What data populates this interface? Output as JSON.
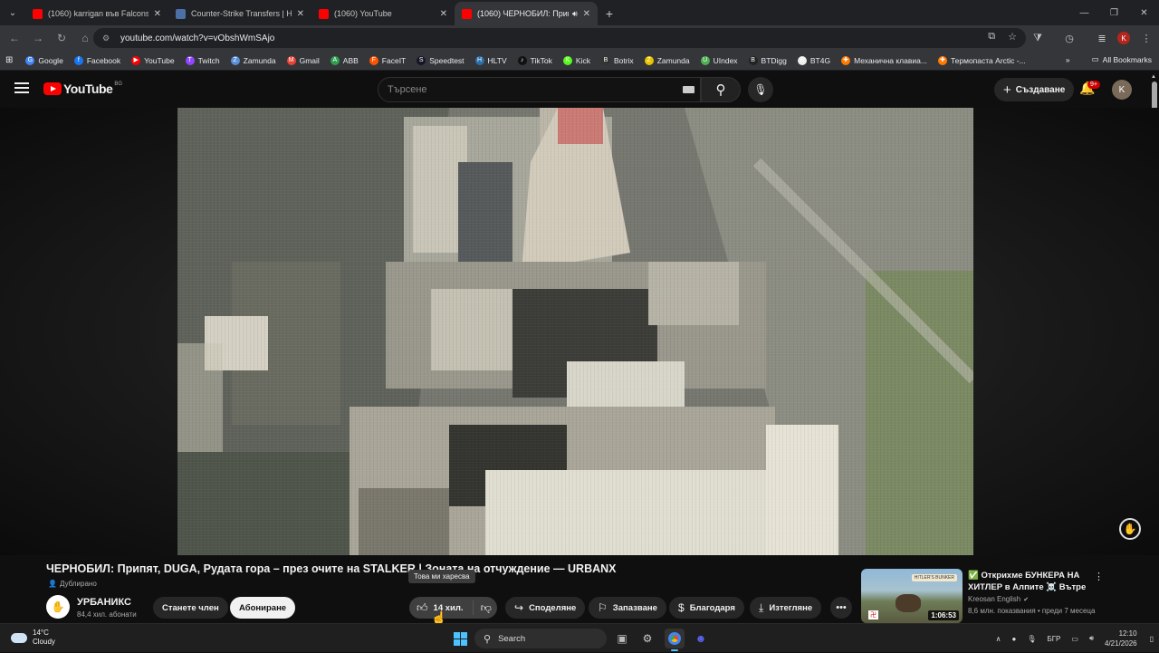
{
  "browser": {
    "tabs": [
      {
        "title": "(1060) karrigan във Falcons?! ",
        "favicon_color": "#ff0000",
        "active": false
      },
      {
        "title": "Counter-Strike Transfers | HLTV",
        "favicon_color": "#4c6fa8",
        "active": false
      },
      {
        "title": "(1060) YouTube",
        "favicon_color": "#ff0000",
        "active": false
      },
      {
        "title": "(1060) ЧЕРНОБИЛ: Припя",
        "favicon_color": "#ff0000",
        "active": true
      }
    ],
    "new_tab": "+",
    "url": "youtube.com/watch?v=vObshWmSAjo",
    "profile_initial": "K",
    "bookmarks": [
      {
        "label": "Google",
        "color": "#4285f4",
        "glyph": "G"
      },
      {
        "label": "Facebook",
        "color": "#1877f2",
        "glyph": "f"
      },
      {
        "label": "YouTube",
        "color": "#ff0000",
        "glyph": "▶"
      },
      {
        "label": "Twitch",
        "color": "#9146ff",
        "glyph": "T"
      },
      {
        "label": "Zamunda",
        "color": "#5a8fd8",
        "glyph": "Z"
      },
      {
        "label": "Gmail",
        "color": "#ea4335",
        "glyph": "M"
      },
      {
        "label": "ABB",
        "color": "#2e9e4f",
        "glyph": "A"
      },
      {
        "label": "FaceIT",
        "color": "#ff5500",
        "glyph": "F"
      },
      {
        "label": "Speedtest",
        "color": "#141526",
        "glyph": "S"
      },
      {
        "label": "HLTV",
        "color": "#2b6ea6",
        "glyph": "H"
      },
      {
        "label": "TikTok",
        "color": "#111111",
        "glyph": "♪"
      },
      {
        "label": "Kick",
        "color": "#53fc18",
        "glyph": "K"
      },
      {
        "label": "Botrix",
        "color": "#333333",
        "glyph": "B"
      },
      {
        "label": "Zamunda",
        "color": "#e8c400",
        "glyph": "Z"
      },
      {
        "label": "UIndex",
        "color": "#4caf50",
        "glyph": "U"
      },
      {
        "label": "BTDigg",
        "color": "#222222",
        "glyph": "B"
      },
      {
        "label": "BT4G",
        "color": "#eeeeee",
        "glyph": "B"
      },
      {
        "label": "Механична клавиа...",
        "color": "#ff7a00",
        "glyph": "✚"
      },
      {
        "label": "Термопаста Arctic -...",
        "color": "#ff7a00",
        "glyph": "✚"
      }
    ],
    "all_bookmarks": "All Bookmarks"
  },
  "youtube": {
    "logo_text": "YouTube",
    "country_code": "BG",
    "search_placeholder": "Търсене",
    "create_label": "Създаване",
    "notif_badge": "9+",
    "avatar_initial": "K"
  },
  "video": {
    "title": "ЧЕРНОБИЛ: Припят, DUGA, Рудата гора – през очите на STALKER | Зоната на отчуждение — URBANX",
    "dubbed_label": "Дублирано",
    "tooltip": "Това ми харесва",
    "channel_name": "УРБАНИКС",
    "channel_subs": "84,4 хил. абонати",
    "join_label": "Станете член",
    "subscribe_label": "Абониране",
    "likes": "14 хил.",
    "share_label": "Споделяне",
    "save_label": "Запазване",
    "thanks_label": "Благодаря",
    "download_label": "Изтегляне"
  },
  "recommended": {
    "title": "✅ Открихме БУНКЕРА НА ХИТЛЕР в Алпите ☠️ Вътре ...",
    "channel": "Kreosan English",
    "meta": "8,6 млн. показвания • преди 7 месеца",
    "duration": "1:06:53",
    "thumb_badge": "HITLER'S BUNKER"
  },
  "taskbar": {
    "temp": "14°C",
    "condition": "Cloudy",
    "search_label": "Search",
    "lang": "БГР",
    "time": "12:10",
    "date": "4/21/2026"
  }
}
